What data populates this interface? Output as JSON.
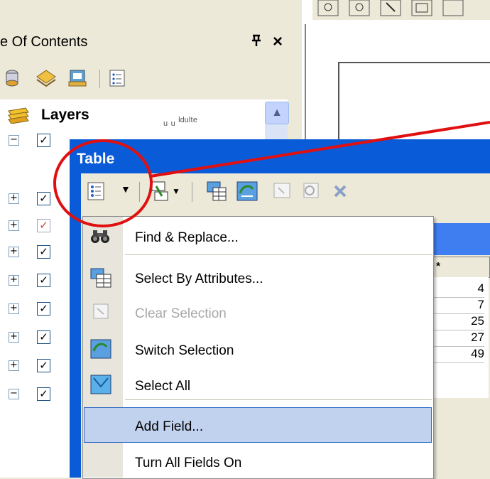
{
  "toc": {
    "title": "e Of Contents",
    "pin_glyph": "ᵖ",
    "close_glyph": "×",
    "toolbar_icons": [
      "list-by-drawing-order-icon",
      "list-by-source-icon",
      "list-by-visibility-icon",
      "list-by-selection-icon",
      "options-icon"
    ],
    "layers_label": "Layers",
    "obscured_layer_text": "ᵤ  ᵤ  ˡᵈᵘˡᵗᵉ"
  },
  "layer_rows": [
    {
      "expand": "⊟",
      "checked": true
    },
    {
      "expand": "⊞",
      "checked": true
    },
    {
      "expand": "⊞",
      "checked": true,
      "partial": true
    },
    {
      "expand": "⊞",
      "checked": true
    },
    {
      "expand": "⊞",
      "checked": true
    },
    {
      "expand": "⊞",
      "checked": true
    },
    {
      "expand": "⊞",
      "checked": true
    },
    {
      "expand": "⊞",
      "checked": true
    },
    {
      "expand": "⊟",
      "checked": true
    }
  ],
  "table_window": {
    "title": "Table",
    "toolbar_icons": [
      "table-options-icon",
      "related-tables-icon",
      "select-by-attributes-icon",
      "switch-selection-icon",
      "clear-selection-icon",
      "zoom-to-selected-icon",
      "delete-selected-icon"
    ],
    "grid_header": "ID *",
    "grid_values": [
      "4",
      "7",
      "25",
      "27",
      "49"
    ]
  },
  "menu": {
    "items": [
      {
        "label": "Find & Replace...",
        "icon": "binoculars-icon",
        "enabled": true
      },
      {
        "label": "Select By Attributes...",
        "icon": "select-by-attributes-icon",
        "enabled": true
      },
      {
        "label": "Clear Selection",
        "icon": "clear-selection-icon",
        "enabled": false
      },
      {
        "label": "Switch Selection",
        "icon": "switch-selection-icon",
        "enabled": true
      },
      {
        "label": "Select All",
        "icon": "select-all-icon",
        "enabled": true
      },
      {
        "label": "Add Field...",
        "icon": "",
        "enabled": true,
        "highlighted": true
      },
      {
        "label": "Turn All Fields On",
        "icon": "",
        "enabled": true
      }
    ]
  },
  "colors": {
    "annotation_red": "#e01010",
    "titlebar_blue": "#0a5bd8",
    "menu_highlight": "#c1d2ee"
  }
}
